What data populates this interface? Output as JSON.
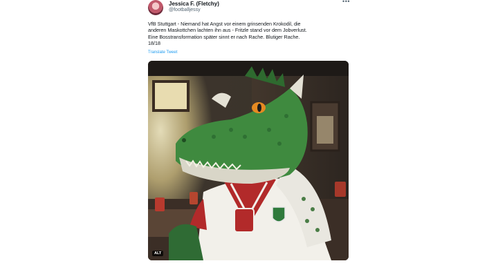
{
  "tweet": {
    "display_name": "Jessica F. (Fletchy)",
    "handle": "@footballjessy",
    "more_icon": "ellipsis-icon",
    "text": "VfB Stuttgart - Niemand hat Angst vor einem grinsenden Krokodil, die\nanderen Maskottchen lachten ihn aus - Fritzle stand vor dem Jobverlust.\nEine Bosstransformation später sinnt er nach Rache. Blutiger Rache.\n18/18",
    "translate_label": "Translate Tweet",
    "link_color": "#1d9bf0",
    "image": {
      "subject": "crocodile mascot in red and white jersey",
      "alt_badge": "ALT"
    }
  }
}
